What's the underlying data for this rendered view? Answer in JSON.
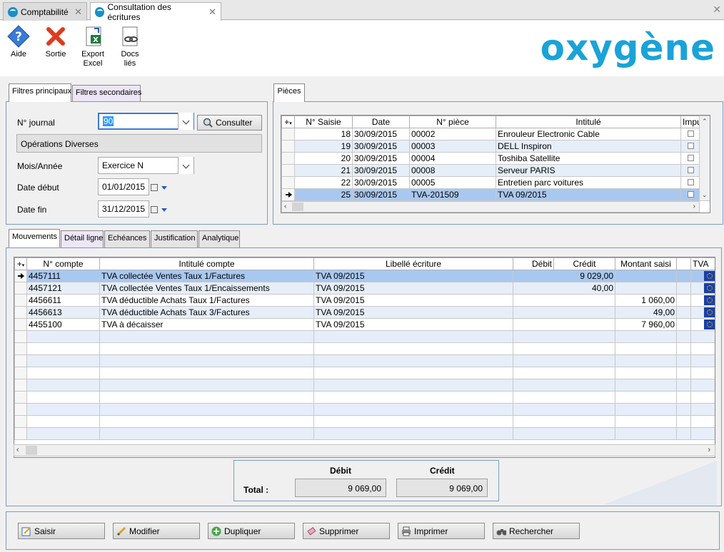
{
  "tabs": [
    {
      "label": "Comptabilité",
      "active": false
    },
    {
      "label": "Consultation des écritures",
      "active": true
    }
  ],
  "toolbar": {
    "aide": "Aide",
    "sortie": "Sortie",
    "export_excel": "Export Excel",
    "docs_lies": "Docs liés"
  },
  "logo": "oxygène",
  "filters": {
    "tabs": [
      "Filtres principaux",
      "Filtres secondaires"
    ],
    "journal_label": "N° journal",
    "journal_value": "90",
    "consulter": "Consulter",
    "journal_name": "Opérations Diverses",
    "mois_label": "Mois/Année",
    "mois_value": "Exercice N",
    "date_debut_label": "Date début",
    "date_debut_value": "01/01/2015",
    "date_fin_label": "Date fin",
    "date_fin_value": "31/12/2015"
  },
  "pieces": {
    "tab": "Pièces",
    "columns": [
      "N° Saisie",
      "Date",
      "N° pièce",
      "Intitulé",
      "Impu"
    ],
    "rows": [
      {
        "saisie": "18",
        "date": "30/09/2015",
        "piece": "00002",
        "intitule": "Enrouleur Electronic Cable"
      },
      {
        "saisie": "19",
        "date": "30/09/2015",
        "piece": "00003",
        "intitule": "DELL Inspiron"
      },
      {
        "saisie": "20",
        "date": "30/09/2015",
        "piece": "00004",
        "intitule": "Toshiba Satellite"
      },
      {
        "saisie": "21",
        "date": "30/09/2015",
        "piece": "00008",
        "intitule": "Serveur PARIS"
      },
      {
        "saisie": "22",
        "date": "30/09/2015",
        "piece": "00005",
        "intitule": "Entretien parc voitures"
      },
      {
        "saisie": "25",
        "date": "30/09/2015",
        "piece": "TVA-201509",
        "intitule": "TVA 09/2015"
      }
    ]
  },
  "mouvements": {
    "tabs": [
      "Mouvements",
      "Détail ligne",
      "Echéances",
      "Justification",
      "Analytique"
    ],
    "columns": [
      "N° compte",
      "Intitulé compte",
      "Libellé écriture",
      "Débit",
      "Crédit",
      "Montant saisi",
      "",
      "TVA"
    ],
    "rows": [
      {
        "compte": "4457111",
        "intitule": "TVA collectée Ventes Taux 1/Factures",
        "libelle": "TVA 09/2015",
        "debit": "9 029,00",
        "credit": ""
      },
      {
        "compte": "4457121",
        "intitule": "TVA collectée Ventes Taux 1/Encaissements",
        "libelle": "TVA 09/2015",
        "debit": "40,00",
        "credit": ""
      },
      {
        "compte": "4456611",
        "intitule": "TVA déductible Achats Taux 1/Factures",
        "libelle": "TVA 09/2015",
        "debit": "",
        "credit": "1 060,00"
      },
      {
        "compte": "4456613",
        "intitule": "TVA déductible Achats Taux 3/Factures",
        "libelle": "TVA 09/2015",
        "debit": "",
        "credit": "49,00"
      },
      {
        "compte": "4455100",
        "intitule": "TVA à décaisser",
        "libelle": "TVA 09/2015",
        "debit": "",
        "credit": "7 960,00"
      }
    ]
  },
  "totals": {
    "debit_label": "Débit",
    "credit_label": "Crédit",
    "total_label": "Total :",
    "debit": "9 069,00",
    "credit": "9 069,00"
  },
  "actions": {
    "saisir": "Saisir",
    "modifier": "Modifier",
    "dupliquer": "Dupliquer",
    "supprimer": "Supprimer",
    "imprimer": "Imprimer",
    "rechercher": "Rechercher"
  },
  "colors": {
    "selection": "#a9c8f0",
    "alt_row": "#e6eef9",
    "panel_border": "#7a9cc6",
    "logo": "#1aa3d9"
  }
}
